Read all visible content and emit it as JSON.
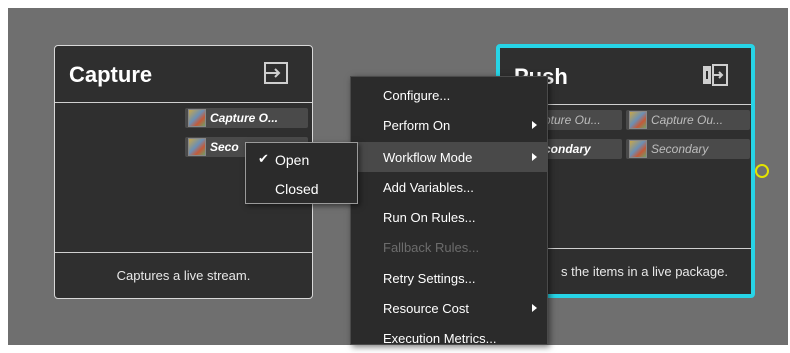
{
  "capture_node": {
    "title": "Capture",
    "ports": [
      {
        "label": "Capture O...",
        "style": "bold"
      },
      {
        "label": "Seco",
        "style": "bold"
      }
    ],
    "description": "Captures a live stream.",
    "icon": "export-box-icon"
  },
  "push_node": {
    "title": "Push",
    "ports_left": [
      {
        "label": "pture Ou...",
        "style": "dim"
      },
      {
        "label": "condary",
        "style": "bold"
      }
    ],
    "ports_right": [
      {
        "label": "Capture Ou...",
        "style": "dim"
      },
      {
        "label": "Secondary",
        "style": "dim"
      }
    ],
    "description": "s the items in a live package.",
    "icon": "push-package-icon",
    "border_color": "#27d4e6",
    "selected": true
  },
  "context_menu": {
    "items": [
      {
        "label": "Configure...",
        "submenu": false,
        "enabled": true
      },
      {
        "label": "Perform On",
        "submenu": true,
        "enabled": true
      },
      {
        "label": "Workflow Mode",
        "submenu": true,
        "enabled": true,
        "highlighted": true
      },
      {
        "label": "Add Variables...",
        "submenu": false,
        "enabled": true
      },
      {
        "label": "Run On Rules...",
        "submenu": false,
        "enabled": true
      },
      {
        "label": "Fallback Rules...",
        "submenu": false,
        "enabled": false
      },
      {
        "label": "Retry Settings...",
        "submenu": false,
        "enabled": true
      },
      {
        "label": "Resource Cost",
        "submenu": true,
        "enabled": true
      },
      {
        "label": "Execution Metrics...",
        "submenu": false,
        "enabled": true
      }
    ]
  },
  "workflow_mode_submenu": {
    "items": [
      {
        "label": "Open",
        "checked": true
      },
      {
        "label": "Closed",
        "checked": false
      }
    ],
    "check_glyph": "✔"
  },
  "colors": {
    "canvas": "#6f6f6f",
    "node_bg": "#2f2f2f",
    "selection": "#27d4e6",
    "connector": "#e4e400"
  }
}
